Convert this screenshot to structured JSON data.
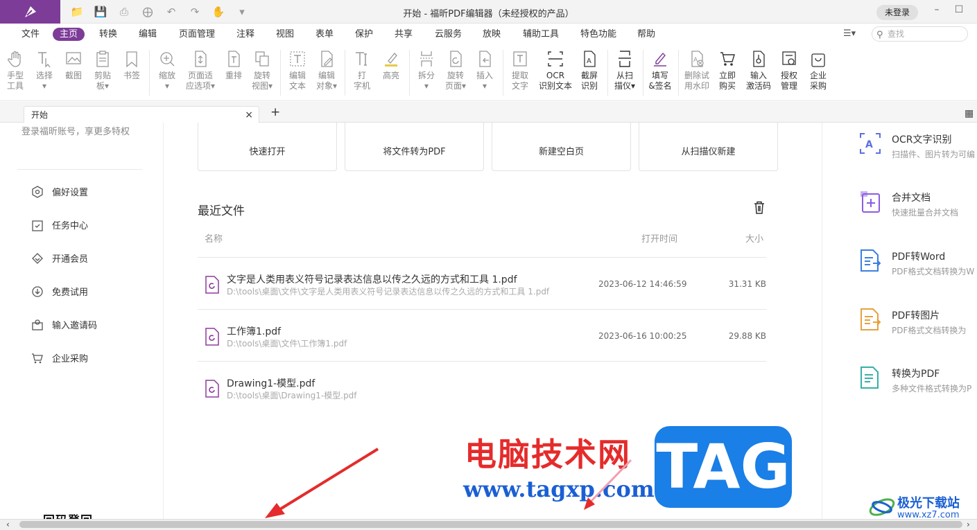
{
  "window": {
    "title": "开始 - 福昕PDF编辑器（未经授权的产品）",
    "login_button": "未登录",
    "minimize": "–",
    "maximize": "☐"
  },
  "menu": {
    "items": [
      "文件",
      "主页",
      "转换",
      "编辑",
      "页面管理",
      "注释",
      "视图",
      "表单",
      "保护",
      "共享",
      "云服务",
      "放映",
      "辅助工具",
      "特色功能",
      "帮助"
    ],
    "active": "主页"
  },
  "search": {
    "placeholder": "查找"
  },
  "ribbon": {
    "buttons": [
      {
        "l1": "手型",
        "l2": "工具"
      },
      {
        "l1": "选择",
        "l2": "▾"
      },
      {
        "l1": "截图",
        "l2": ""
      },
      {
        "l1": "剪贴",
        "l2": "板▾"
      },
      {
        "l1": "书签",
        "l2": ""
      },
      {
        "l1": "缩放",
        "l2": "▾"
      },
      {
        "l1": "页面适",
        "l2": "应选项▾"
      },
      {
        "l1": "重排",
        "l2": ""
      },
      {
        "l1": "旋转",
        "l2": "视图▾"
      },
      {
        "l1": "编辑",
        "l2": "文本"
      },
      {
        "l1": "编辑",
        "l2": "对象▾"
      },
      {
        "l1": "打",
        "l2": "字机"
      },
      {
        "l1": "高亮",
        "l2": ""
      },
      {
        "l1": "拆分",
        "l2": "▾"
      },
      {
        "l1": "旋转",
        "l2": "页面▾"
      },
      {
        "l1": "插入",
        "l2": "▾"
      },
      {
        "l1": "提取",
        "l2": "文字"
      },
      {
        "l1": "OCR",
        "l2": "识别文本"
      },
      {
        "l1": "截屏",
        "l2": "识别"
      },
      {
        "l1": "从扫",
        "l2": "描仪▾"
      },
      {
        "l1": "填写",
        "l2": "&签名"
      },
      {
        "l1": "删除试",
        "l2": "用水印"
      },
      {
        "l1": "立即",
        "l2": "购买"
      },
      {
        "l1": "输入",
        "l2": "激活码"
      },
      {
        "l1": "授权",
        "l2": "管理"
      },
      {
        "l1": "企业",
        "l2": "采购"
      }
    ]
  },
  "tabs": {
    "doc_tab": "开始",
    "close": "×",
    "add": "+"
  },
  "left_panel": {
    "login_tip": "登录福昕账号，享更多特权",
    "items": [
      "偏好设置",
      "任务中心",
      "开通会员",
      "免费试用",
      "输入邀请码",
      "企业采购"
    ],
    "bottom_text": "回码登回"
  },
  "quick_actions": [
    "快速打开",
    "将文件转为PDF",
    "新建空白页",
    "从扫描仪新建"
  ],
  "recent": {
    "title": "最近文件",
    "columns": {
      "name": "名称",
      "time": "打开时间",
      "size": "大小"
    },
    "files": [
      {
        "name": "文字是人类用表义符号记录表达信息以传之久远的方式和工具 1.pdf",
        "path": "D:\\tools\\桌面\\文件\\文字是人类用表义符号记录表达信息以传之久远的方式和工具 1.pdf",
        "time": "2023-06-12 14:46:59",
        "size": "31.31 KB"
      },
      {
        "name": "工作簿1.pdf",
        "path": "D:\\tools\\桌面\\文件\\工作簿1.pdf",
        "time": "2023-06-16 10:00:25",
        "size": "29.88 KB"
      },
      {
        "name": "Drawing1-模型.pdf",
        "path": "D:\\tools\\桌面\\Drawing1-模型.pdf",
        "time": "",
        "size": ""
      }
    ]
  },
  "right_panel": {
    "items": [
      {
        "title": "OCR文字识别",
        "sub": "扫描件、图片转为可编",
        "color": "#5b6fe0"
      },
      {
        "title": "合并文档",
        "sub": "快速批量合并文档",
        "color": "#8a5ce0"
      },
      {
        "title": "PDF转Word",
        "sub": "PDF格式文档转换为W",
        "color": "#3b7fe0"
      },
      {
        "title": "PDF转图片",
        "sub": "PDF格式文档转换为",
        "color": "#e8a040"
      },
      {
        "title": "转换为PDF",
        "sub": "多种文件格式转换为P",
        "color": "#35b0a6"
      }
    ]
  },
  "scrollbar": {
    "left": "‹",
    "right": "›"
  },
  "watermark": {
    "cn": "电脑技术网",
    "url": "www.tagxp.com",
    "tag": "TAG",
    "site_name": "极光下载站",
    "site_url": "www.xz7.com"
  },
  "colors": {
    "accent": "#7d3c98",
    "pdf_icon": "#8e3a9e"
  }
}
